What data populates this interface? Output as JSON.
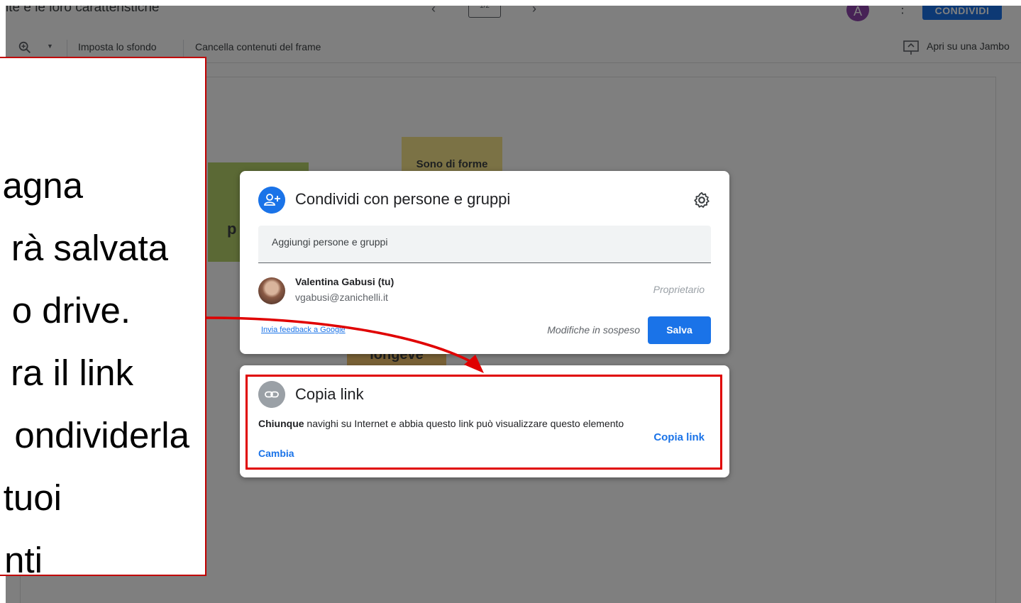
{
  "app": {
    "doc_title": "ite e le loro caratteristiche",
    "frame_counter": "1/2",
    "user_initial": "A",
    "share_button": "CONDIVIDI",
    "toolbar": {
      "set_background": "Imposta lo sfondo",
      "clear_frame": "Cancella contenuti del frame",
      "open_on_jamboard": "Apri su una Jambo"
    },
    "stickies": {
      "yellow": "Sono di forme",
      "green_letter": "p",
      "orange": "longeve"
    }
  },
  "instruction": {
    "lines": [
      "agna",
      "rà salvata",
      "o drive.",
      "ra il link",
      "ondividerla",
      "tuoi",
      "nti"
    ]
  },
  "share_dialog": {
    "title": "Condividi con persone e gruppi",
    "input_placeholder": "Aggiungi persone e gruppi",
    "user_name": "Valentina Gabusi (tu)",
    "user_email": "vgabusi@zanichelli.it",
    "user_role": "Proprietario",
    "feedback_link": "Invia feedback a Google",
    "pending_text": "Modifiche in sospeso",
    "save_button": "Salva"
  },
  "link_dialog": {
    "title": "Copia link",
    "desc_bold": "Chiunque",
    "desc_rest": " navighi su Internet e abbia questo link può visualizzare questo elemento",
    "change_link": "Cambia",
    "copy_link": "Copia link"
  },
  "colors": {
    "accent": "#1a73e8",
    "highlight_red": "#e00000",
    "scrim": "rgba(0,0,0,0.5)"
  }
}
